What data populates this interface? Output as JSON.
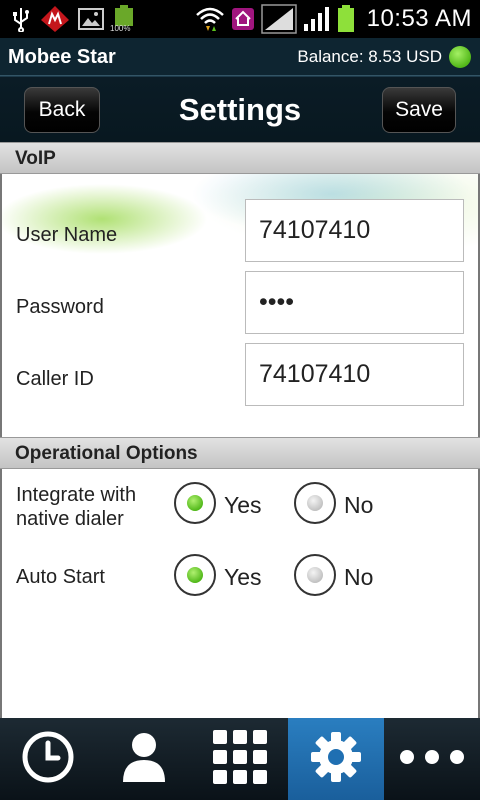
{
  "status_bar": {
    "time": "10:53 AM",
    "battery_small_label": "100%",
    "icons": [
      "usb-icon",
      "mobee-notification-icon",
      "image-icon",
      "battery-small-icon",
      "wifi-icon",
      "home-app-icon",
      "signal-icon",
      "signal-icon",
      "battery-icon"
    ]
  },
  "app": {
    "name": "Mobee Star",
    "balance": "Balance: 8.53 USD",
    "balance_status_color": "#5cc21f"
  },
  "header": {
    "back_label": "Back",
    "title": "Settings",
    "save_label": "Save"
  },
  "voip": {
    "section_title": "VoIP",
    "fields": [
      {
        "label": "User Name",
        "value": "74107410"
      },
      {
        "label": "Password",
        "value": "••••"
      },
      {
        "label": "Caller ID",
        "value": "74107410"
      }
    ]
  },
  "options": {
    "section_title": "Operational Options",
    "items": [
      {
        "label_line1": "Integrate with",
        "label_line2": "native dialer",
        "yes_label": "Yes",
        "no_label": "No",
        "selected": "Yes"
      },
      {
        "label_line1": "Auto Start",
        "label_line2": "",
        "yes_label": "Yes",
        "no_label": "No",
        "selected": "Yes"
      }
    ]
  },
  "bottom_nav": {
    "items": [
      "clock-icon",
      "contact-icon",
      "dialpad-icon",
      "gear-icon",
      "more-icon"
    ],
    "active": "gear-icon",
    "active_color": "#1f6fb2"
  }
}
